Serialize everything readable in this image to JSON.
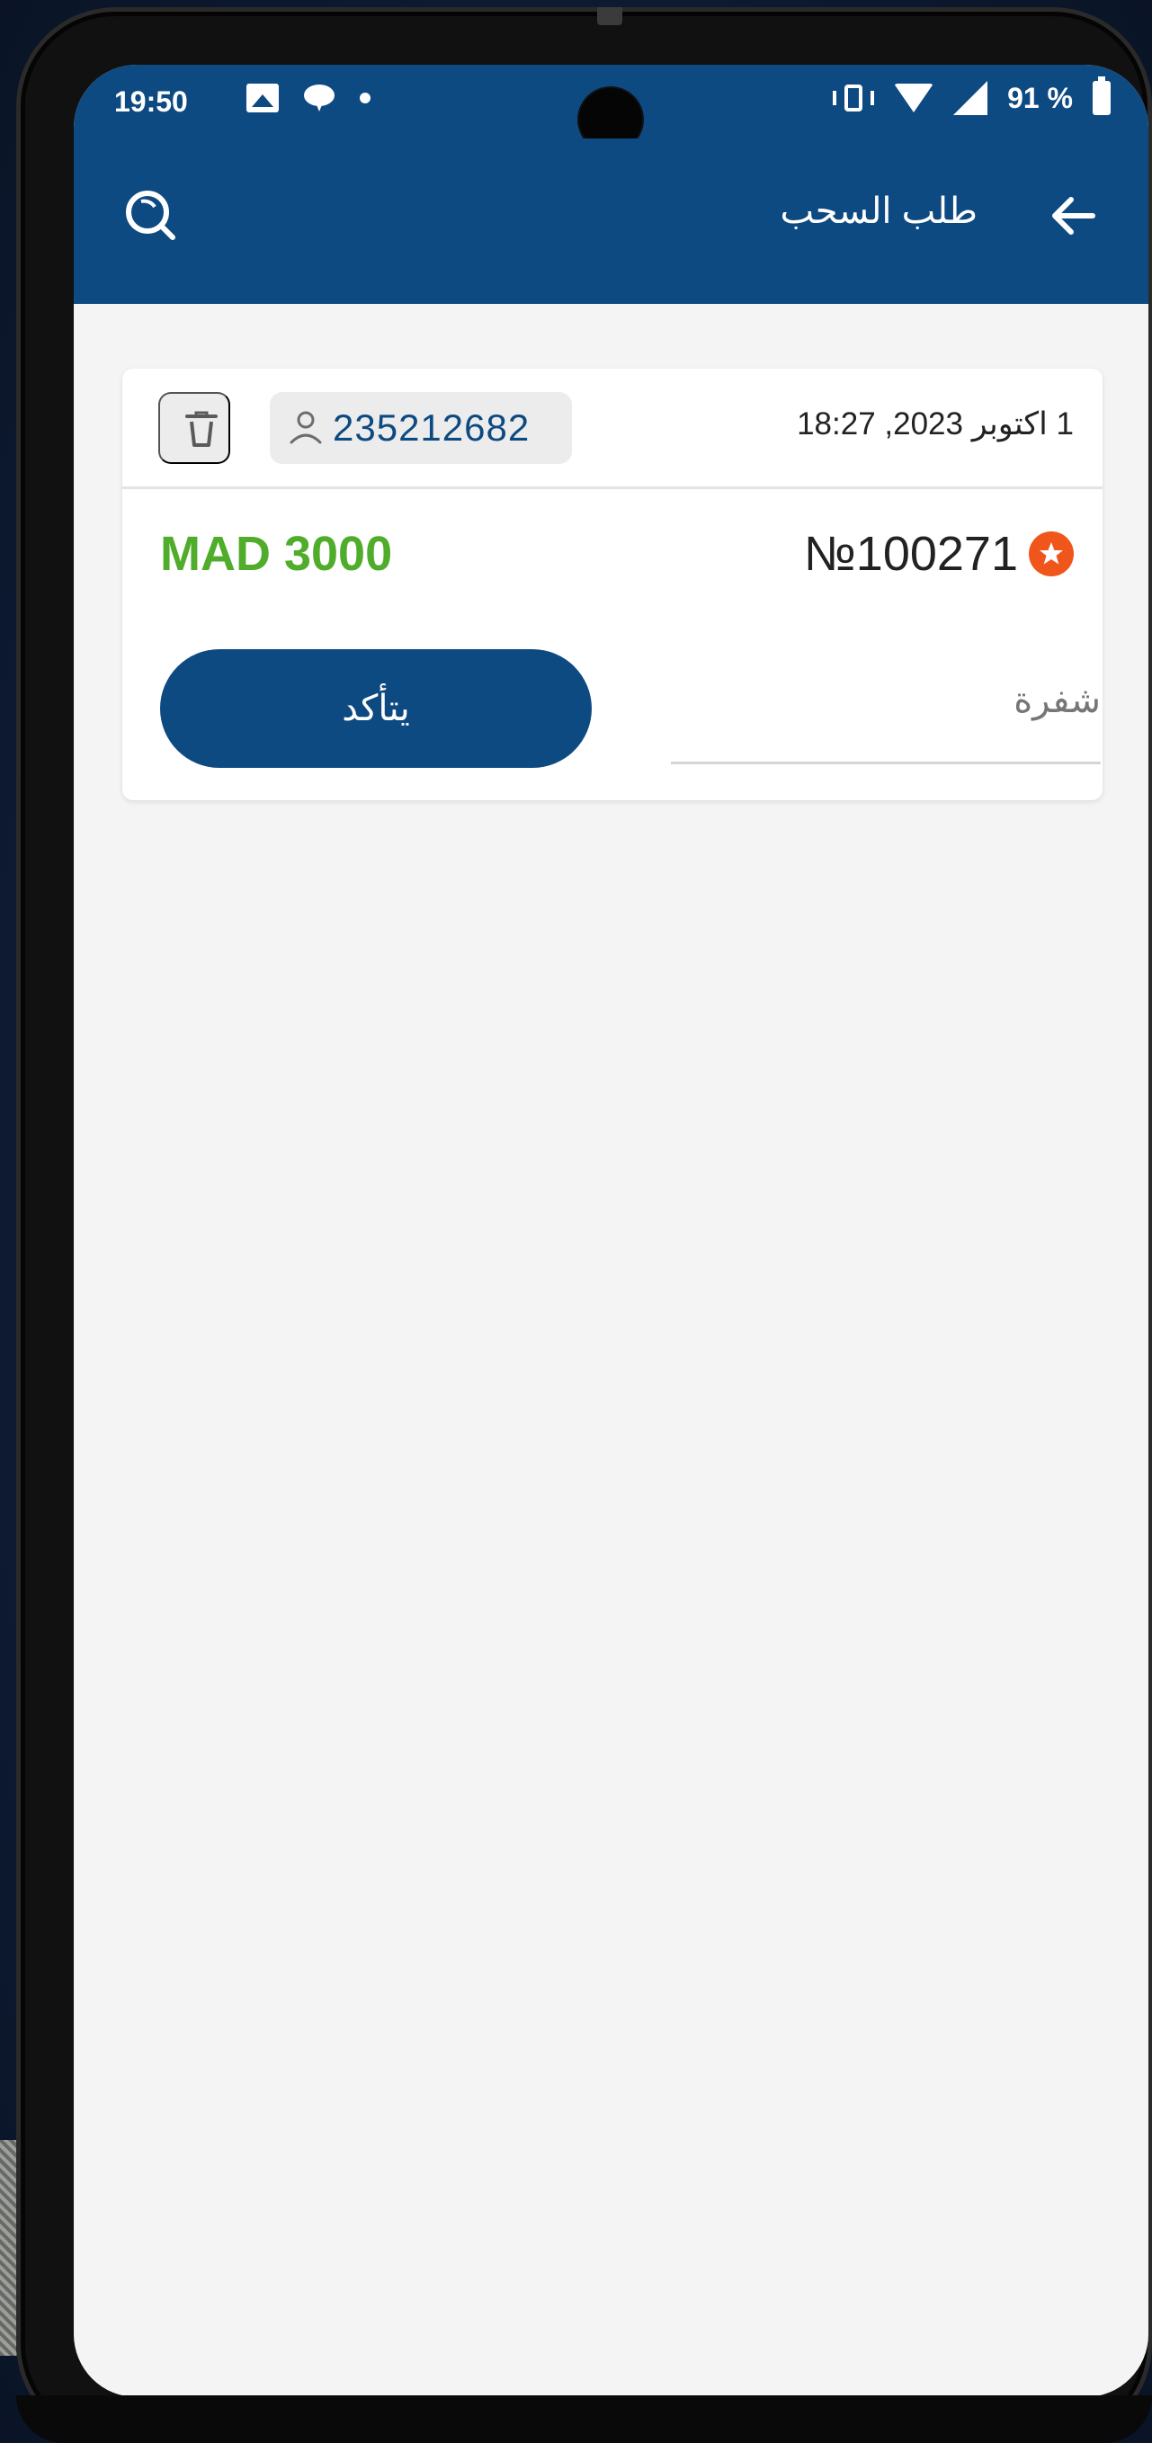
{
  "status_bar": {
    "time": "19:50",
    "battery": "91 %",
    "icons": [
      "gallery-icon",
      "chat-icon",
      "dot-icon",
      "vibrate-icon",
      "wifi-icon",
      "signal-icon",
      "battery-icon"
    ]
  },
  "app_bar": {
    "title": "طلب السحب",
    "search_icon": "search-icon",
    "back_icon": "back-arrow-icon"
  },
  "order": {
    "date": "1 اكتوبر 2023, 18:27",
    "user_id": "235212682",
    "number": "№100271",
    "amount": "MAD 3000",
    "code_placeholder": "شفرة",
    "confirm_label": "يتأكد"
  },
  "colors": {
    "primary": "#0e4a82",
    "amount_green": "#4fad2b",
    "star_orange": "#f0561b",
    "background": "#f4f4f4"
  }
}
